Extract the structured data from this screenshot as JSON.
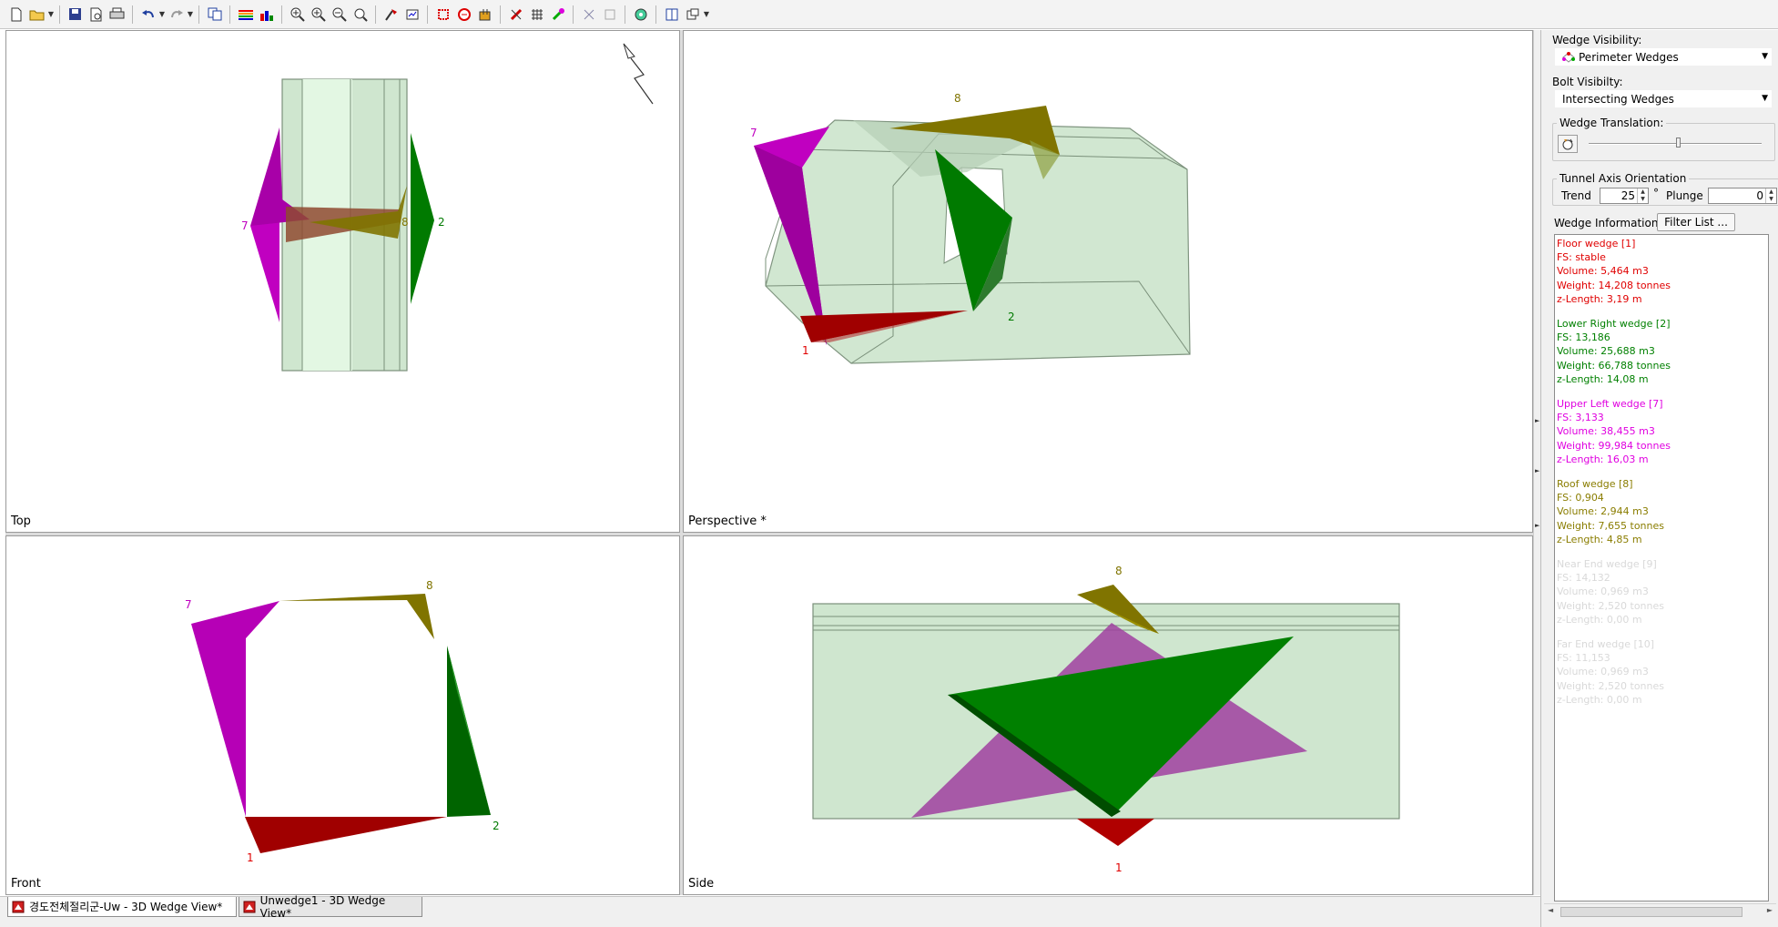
{
  "toolbar": {
    "icons": [
      "new-icon",
      "open-icon",
      "save-icon",
      "print-preview-icon",
      "print-icon",
      "undo-icon",
      "redo-icon",
      "copy-icon",
      "color-scheme-icon",
      "chart-icon",
      "zoom-all-icon",
      "zoom-in-icon",
      "zoom-out-icon",
      "zoom-extents-icon",
      "select-icon",
      "scale-icon",
      "perimeter-wedges-icon",
      "wedge-icon",
      "bolts-icon",
      "add-bolt-icon",
      "bolt-pattern-icon",
      "shotcrete-icon",
      "joint-icon",
      "support-icon",
      "analysis-icon",
      "layout-icon",
      "view-options-icon"
    ]
  },
  "viewports": {
    "top": {
      "label": "Top",
      "wedge_labels": {
        "w7": "7",
        "w8": "8",
        "w2": "2"
      }
    },
    "perspective": {
      "label": "Perspective *",
      "wedge_labels": {
        "w7": "7",
        "w8": "8",
        "w2": "2",
        "w1": "1"
      }
    },
    "front": {
      "label": "Front",
      "wedge_labels": {
        "w7": "7",
        "w8": "8",
        "w2": "2",
        "w1": "1"
      }
    },
    "side": {
      "label": "Side",
      "wedge_labels": {
        "w8": "8",
        "w1": "1"
      }
    }
  },
  "colors": {
    "tunnel_fill": "#cfe8cf",
    "tunnel_edge": "#8aa58a",
    "floor_wedge": "#a00000",
    "lower_right_wedge": "#007a00",
    "upper_left_wedge": "#c000c0",
    "roof_wedge": "#807400",
    "faded_wedge": "#c8c8c8"
  },
  "doc_tabs": [
    {
      "label": "경도전체절리군-Uw - 3D Wedge View*",
      "active": true
    },
    {
      "label": "Unwedge1 - 3D Wedge View*",
      "active": false
    }
  ],
  "side_panel": {
    "wedge_visibility_label": "Wedge Visibility:",
    "wedge_visibility_value": "Perimeter Wedges",
    "bolt_visibility_label": "Bolt Visibilty:",
    "bolt_visibility_value": "Intersecting Wedges",
    "wedge_translation_label": "Wedge Translation:",
    "wedge_translation_fraction": 0.52,
    "tunnel_axis_label": "Tunnel Axis Orientation",
    "trend_label": "Trend",
    "trend_value": "25",
    "degree_symbol": "°",
    "plunge_label": "Plunge",
    "plunge_value": "0",
    "wedge_info_label": "Wedge Information:",
    "filter_list_label": "Filter List ..."
  },
  "wedge_info": [
    {
      "color": "#e00000",
      "lines": [
        "Floor wedge [1]",
        "FS: stable",
        "Volume: 5,464 m3",
        "Weight: 14,208 tonnes",
        "z-Length: 3,19 m"
      ]
    },
    {
      "color": "#008000",
      "lines": [
        "Lower Right wedge [2]",
        "FS: 13,186",
        "Volume: 25,688 m3",
        "Weight: 66,788 tonnes",
        "z-Length: 14,08 m"
      ]
    },
    {
      "color": "#e000e0",
      "lines": [
        "Upper Left wedge [7]",
        "FS: 3,133",
        "Volume: 38,455 m3",
        "Weight: 99,984 tonnes",
        "z-Length: 16,03 m"
      ]
    },
    {
      "color": "#8a7d00",
      "lines": [
        "Roof wedge [8]",
        "FS: 0,904",
        "Volume: 2,944 m3",
        "Weight: 7,655 tonnes",
        "z-Length: 4,85 m"
      ]
    },
    {
      "color": "#d9d9d9",
      "lines": [
        "Near End wedge [9]",
        "FS: 14,132",
        "Volume: 0,969 m3",
        "Weight: 2,520 tonnes",
        "z-Length: 0,00 m"
      ]
    },
    {
      "color": "#d9d9d9",
      "lines": [
        "Far End wedge [10]",
        "FS: 11,153",
        "Volume: 0,969 m3",
        "Weight: 2,520 tonnes",
        "z-Length: 0,00 m"
      ]
    }
  ]
}
